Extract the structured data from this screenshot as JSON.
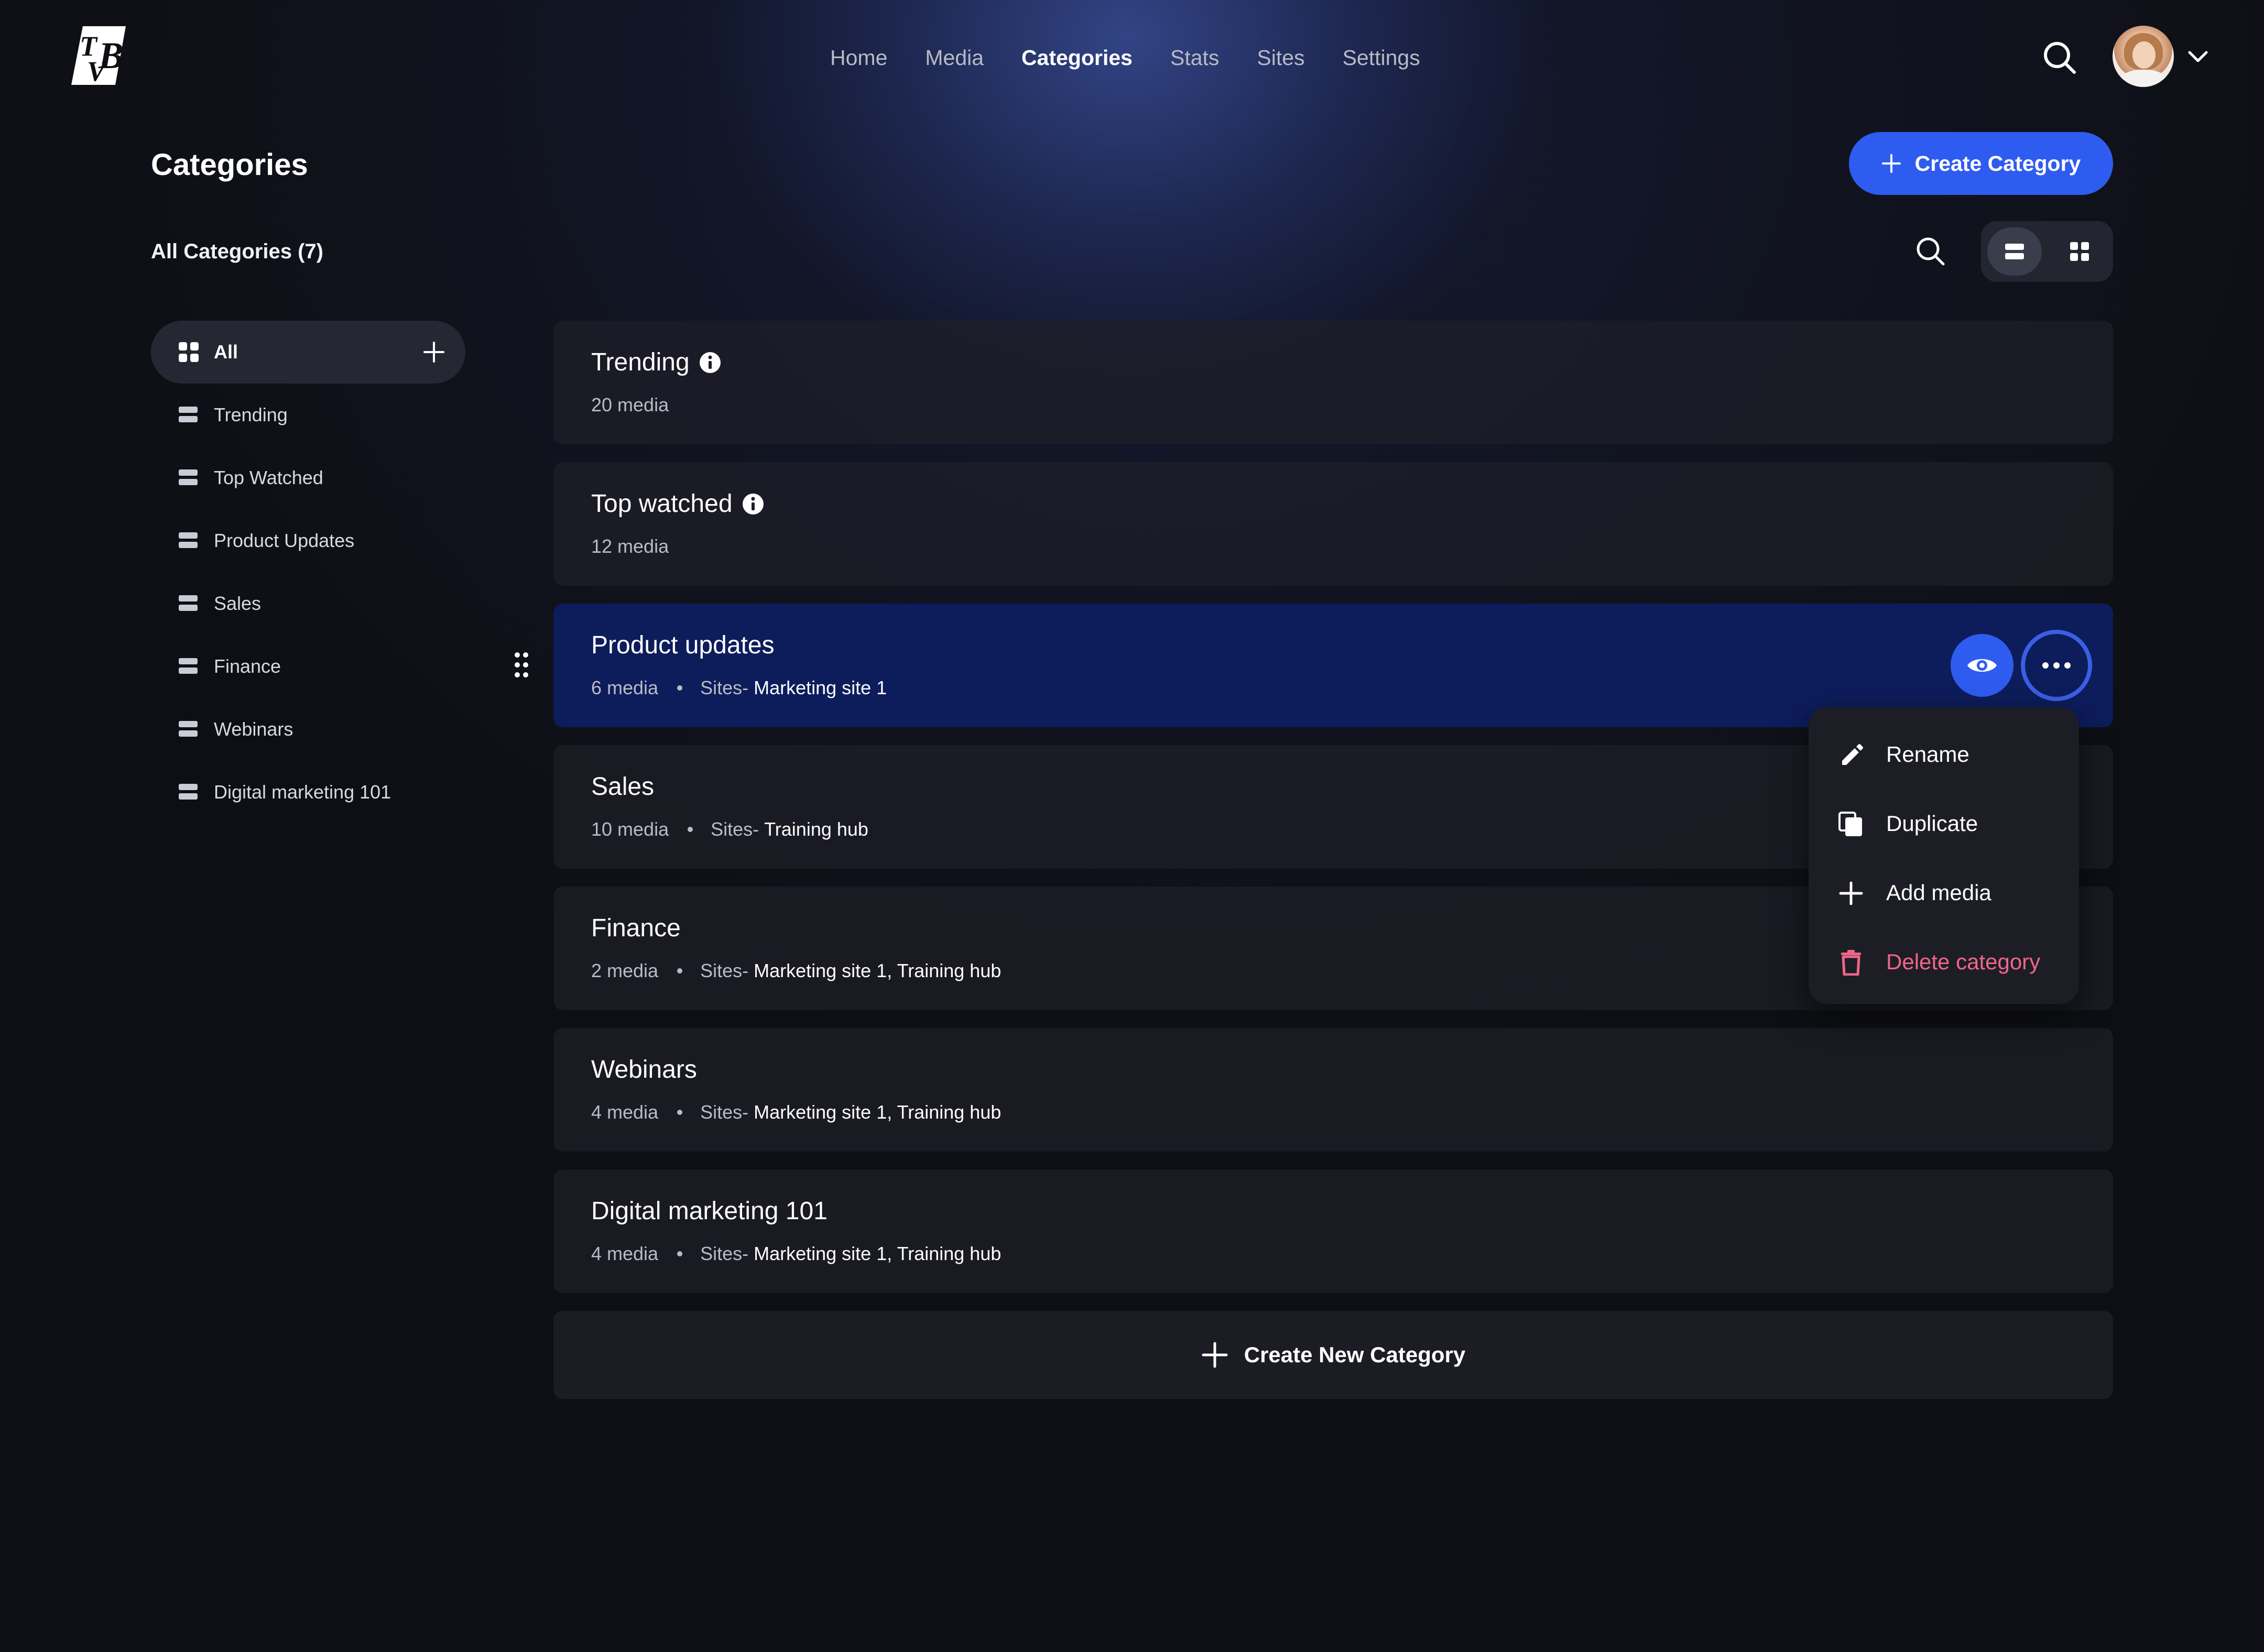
{
  "nav": {
    "items": [
      {
        "label": "Home",
        "active": false
      },
      {
        "label": "Media",
        "active": false
      },
      {
        "label": "Categories",
        "active": true
      },
      {
        "label": "Stats",
        "active": false
      },
      {
        "label": "Sites",
        "active": false
      },
      {
        "label": "Settings",
        "active": false
      }
    ],
    "logo_text": "TVB"
  },
  "header": {
    "title": "Categories",
    "create_button_label": "Create Category",
    "all_count_label": "All Categories (7)"
  },
  "sidebar": {
    "all_label": "All",
    "items": [
      {
        "label": "Trending"
      },
      {
        "label": "Top Watched"
      },
      {
        "label": "Product Updates"
      },
      {
        "label": "Sales"
      },
      {
        "label": "Finance"
      },
      {
        "label": "Webinars"
      },
      {
        "label": "Digital marketing 101"
      }
    ]
  },
  "categories": [
    {
      "title": "Trending",
      "media": "20 media",
      "info": true
    },
    {
      "title": "Top watched",
      "media": "12 media",
      "info": true
    },
    {
      "title": "Product updates",
      "media": "6 media",
      "sites_prefix": "Sites-",
      "sites": "Marketing site 1",
      "selected": true
    },
    {
      "title": "Sales",
      "media": "10 media",
      "sites_prefix": "Sites-",
      "sites": "Training hub"
    },
    {
      "title": "Finance",
      "media": "2 media",
      "sites_prefix": "Sites-",
      "sites": "Marketing site 1, Training hub"
    },
    {
      "title": "Webinars",
      "media": "4 media",
      "sites_prefix": "Sites-",
      "sites": "Marketing site 1, Training hub"
    },
    {
      "title": "Digital marketing 101",
      "media": "4 media",
      "sites_prefix": "Sites-",
      "sites": "Marketing site 1, Training hub"
    }
  ],
  "create_new_label": "Create New Category",
  "menu": {
    "items": [
      {
        "label": "Rename",
        "icon": "pencil-icon"
      },
      {
        "label": "Duplicate",
        "icon": "duplicate-icon"
      },
      {
        "label": "Add media",
        "icon": "plus-icon"
      },
      {
        "label": "Delete category",
        "icon": "trash-icon",
        "danger": true
      }
    ]
  },
  "colors": {
    "accent": "#2f5cf0",
    "selected_card": "#0d1c5b",
    "danger": "#f0668a",
    "background": "#0e0f14"
  }
}
